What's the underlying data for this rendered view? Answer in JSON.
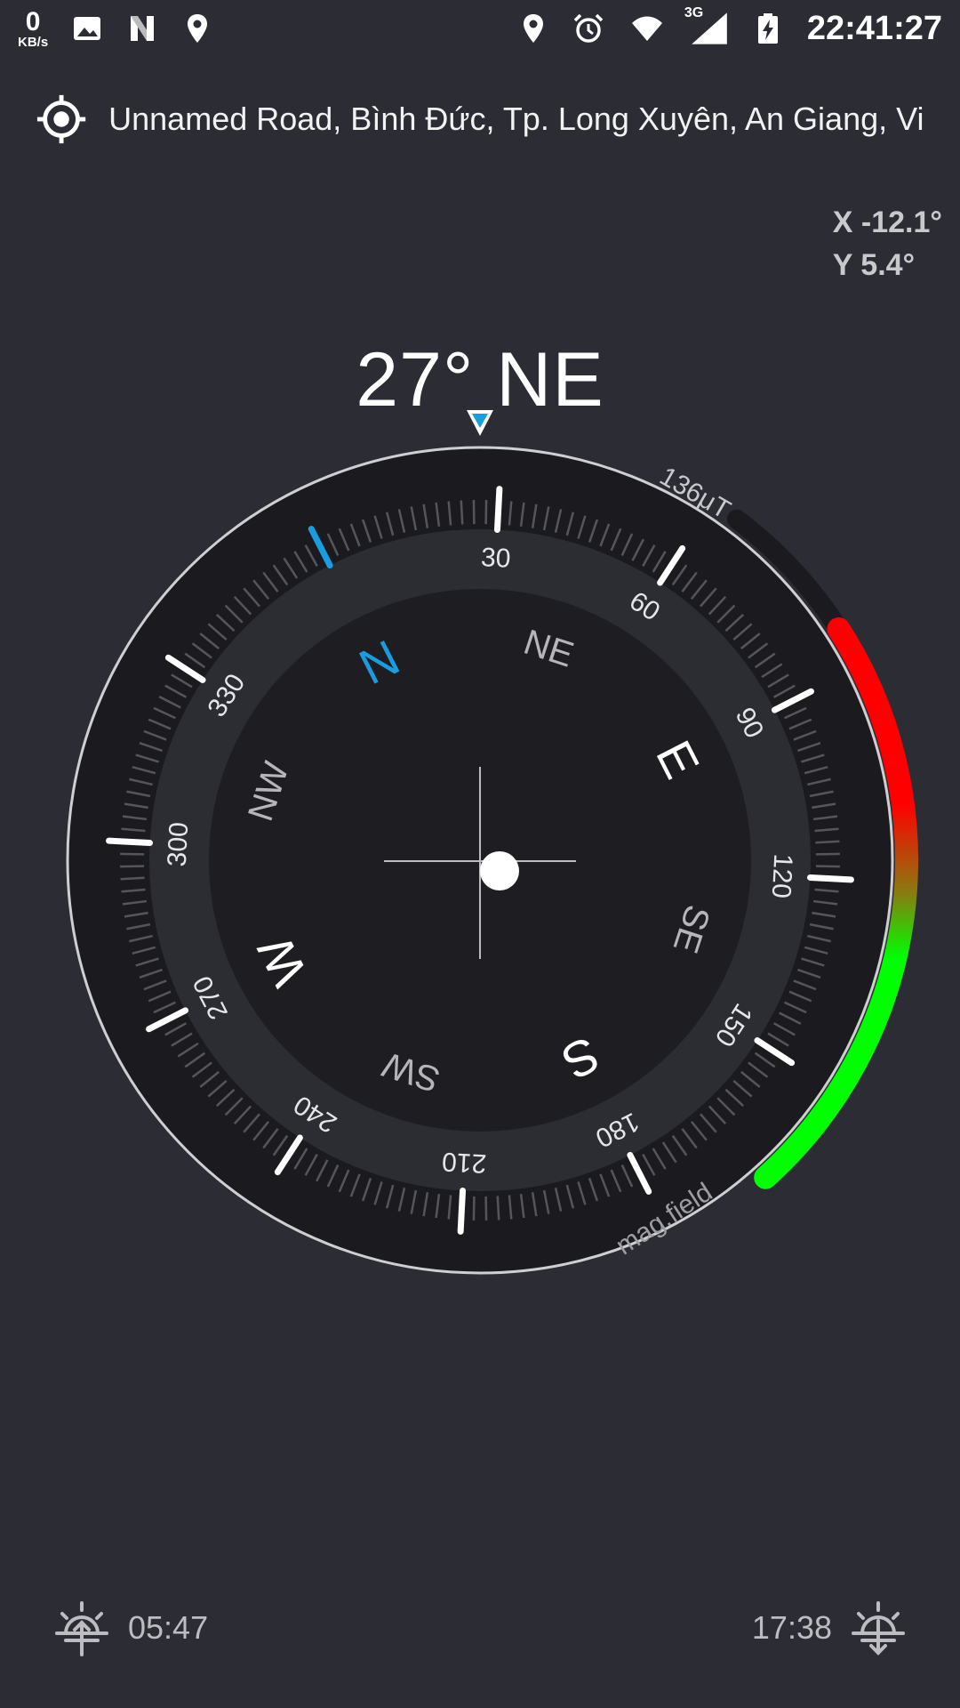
{
  "status_bar": {
    "net_speed_value": "0",
    "net_speed_unit": "KB/s",
    "left_icons": [
      "image-icon",
      "n-logo-icon",
      "location-pin-icon"
    ],
    "right_icons": [
      "location-pin-icon",
      "alarm-icon",
      "wifi-icon",
      "signal-3g-icon",
      "battery-charging-icon"
    ],
    "network_type": "3G",
    "time": "22:41:27"
  },
  "location": {
    "icon": "gps-target-icon",
    "address": "Unnamed Road, Bình Đức, Tp. Long Xuyên, An Giang, Vi..."
  },
  "tilt": {
    "x": "X -12.1°",
    "y": "Y 5.4°"
  },
  "heading": {
    "label": "27° NE",
    "degrees": 27
  },
  "compass": {
    "degree_labels": [
      "30",
      "60",
      "90",
      "120",
      "150",
      "180",
      "210",
      "240",
      "270",
      "300",
      "330"
    ],
    "cardinal": {
      "N": "N",
      "E": "E",
      "S": "S",
      "W": "W"
    },
    "intercardinal": {
      "NE": "NE",
      "SE": "SE",
      "SW": "SW",
      "NW": "NW"
    },
    "north_color": "#1a9de0"
  },
  "mag_field": {
    "value_label": "136μT",
    "caption": "mag.field",
    "level": 0.8,
    "colors": {
      "high": "#ff0000",
      "low": "#00ff00",
      "track": "#1b1b1f"
    }
  },
  "sun": {
    "sunrise_icon": "sunrise-icon",
    "sunrise_time": "05:47",
    "sunset_icon": "sunset-icon",
    "sunset_time": "17:38"
  }
}
